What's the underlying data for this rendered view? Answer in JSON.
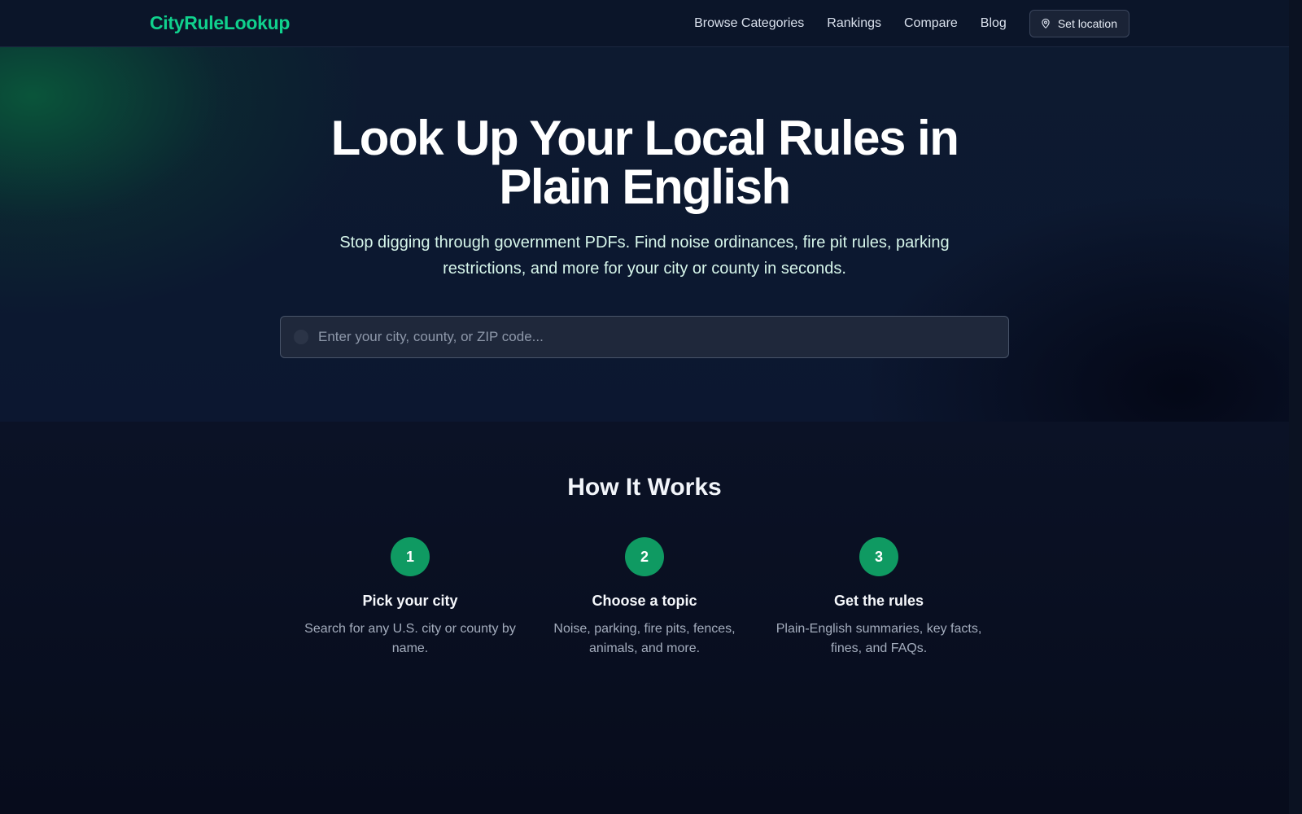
{
  "nav": {
    "brand": "CityRuleLookup",
    "links": [
      "Browse Categories",
      "Rankings",
      "Compare",
      "Blog"
    ],
    "set_location": {
      "label": "Set location",
      "icon": "map-pin-icon"
    }
  },
  "hero": {
    "title_line1": "Look Up Your Local Rules in",
    "title_line2": "Plain English",
    "subtitle": "Stop digging through government PDFs. Find noise ordinances, fire pit rules, parking restrictions, and more for your city or county in seconds.",
    "search": {
      "placeholder": "Enter your city, county, or ZIP code...",
      "value": "",
      "icon": "search-icon"
    }
  },
  "how_it_works": {
    "title": "How It Works",
    "steps": [
      {
        "number": "1",
        "title": "Pick your city",
        "desc": "Search for any U.S. city or county by name."
      },
      {
        "number": "2",
        "title": "Choose a topic",
        "desc": "Noise, parking, fire pits, fences, animals, and more."
      },
      {
        "number": "3",
        "title": "Get the rules",
        "desc": "Plain-English summaries, key facts, fines, and FAQs."
      }
    ]
  },
  "colors": {
    "brand": "#10d18d",
    "step_circle": "#0f9a62",
    "background": "#070c1c"
  }
}
